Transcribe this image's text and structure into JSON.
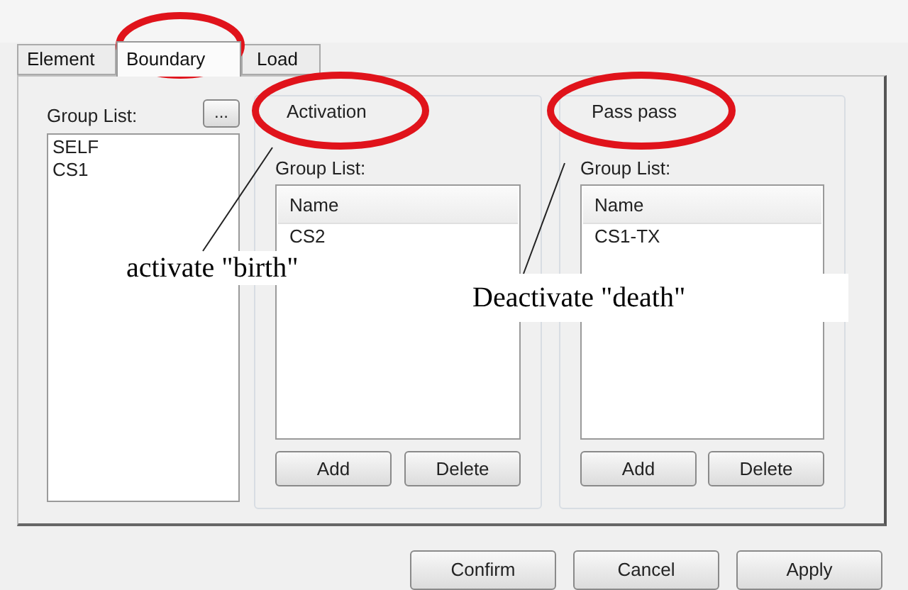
{
  "tabs": [
    {
      "label": "Element",
      "selected": false
    },
    {
      "label": "Boundary",
      "selected": true
    },
    {
      "label": "Load",
      "selected": false
    }
  ],
  "group_list": {
    "label": "Group List:",
    "browse_button": "...",
    "items": [
      "SELF",
      "CS1"
    ]
  },
  "panels": [
    {
      "title": "Activation",
      "list_label": "Group List:",
      "column": "Name",
      "rows": [
        "CS2"
      ],
      "buttons": [
        "Add",
        "Delete"
      ]
    },
    {
      "title": "Pass pass",
      "list_label": "Group List:",
      "column": "Name",
      "rows": [
        "CS1-TX"
      ],
      "buttons": [
        "Add",
        "Delete"
      ]
    }
  ],
  "dialog_buttons": [
    "Confirm",
    "Cancel",
    "Apply"
  ],
  "annotations": [
    {
      "text": "activate \"birth\""
    },
    {
      "text": "Deactivate \"death\""
    }
  ]
}
